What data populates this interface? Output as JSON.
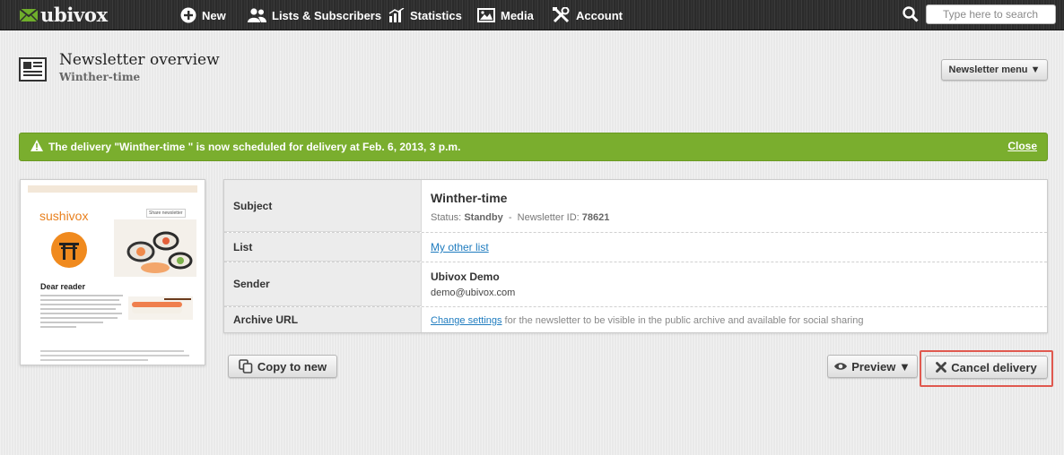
{
  "brand": {
    "name": "ubivox"
  },
  "nav": [
    {
      "label": "New",
      "icon": "plus-circle-icon"
    },
    {
      "label": "Lists & Subscribers",
      "icon": "users-icon"
    },
    {
      "label": "Statistics",
      "icon": "bar-chart-icon"
    },
    {
      "label": "Media",
      "icon": "image-icon"
    },
    {
      "label": "Account",
      "icon": "tools-icon"
    }
  ],
  "search": {
    "placeholder": "Type here to search",
    "icon": "search-icon"
  },
  "header": {
    "title": "Newsletter overview",
    "subtitle": "Winther-time",
    "menu_label": "Newsletter menu ▼",
    "icon": "newsletter-icon"
  },
  "alert": {
    "message": "The delivery \"Winther-time \" is now scheduled for delivery at Feb. 6, 2013, 3 p.m.",
    "close_label": "Close",
    "color": "#7aae2e",
    "icon": "warning-icon"
  },
  "thumbnail": {
    "brand": "sushivox",
    "share_label": "Share newsletter",
    "heading": "Dear reader"
  },
  "details": {
    "subject_label": "Subject",
    "subject_value": "Winther-time",
    "status_prefix": "Status:",
    "status_value": "Standby",
    "status_sep": "-",
    "id_prefix": "Newsletter ID:",
    "id_value": "78621",
    "list_label": "List",
    "list_value": "My other list",
    "sender_label": "Sender",
    "sender_name": "Ubivox Demo",
    "sender_email": "demo@ubivox.com",
    "archive_label": "Archive URL",
    "archive_link": "Change settings",
    "archive_text": " for the newsletter to be visible in the public archive and available for social sharing"
  },
  "actions": {
    "copy_label": "Copy to new",
    "preview_label": "Preview ▼",
    "cancel_label": "Cancel delivery",
    "highlight_color": "#e0594f"
  }
}
